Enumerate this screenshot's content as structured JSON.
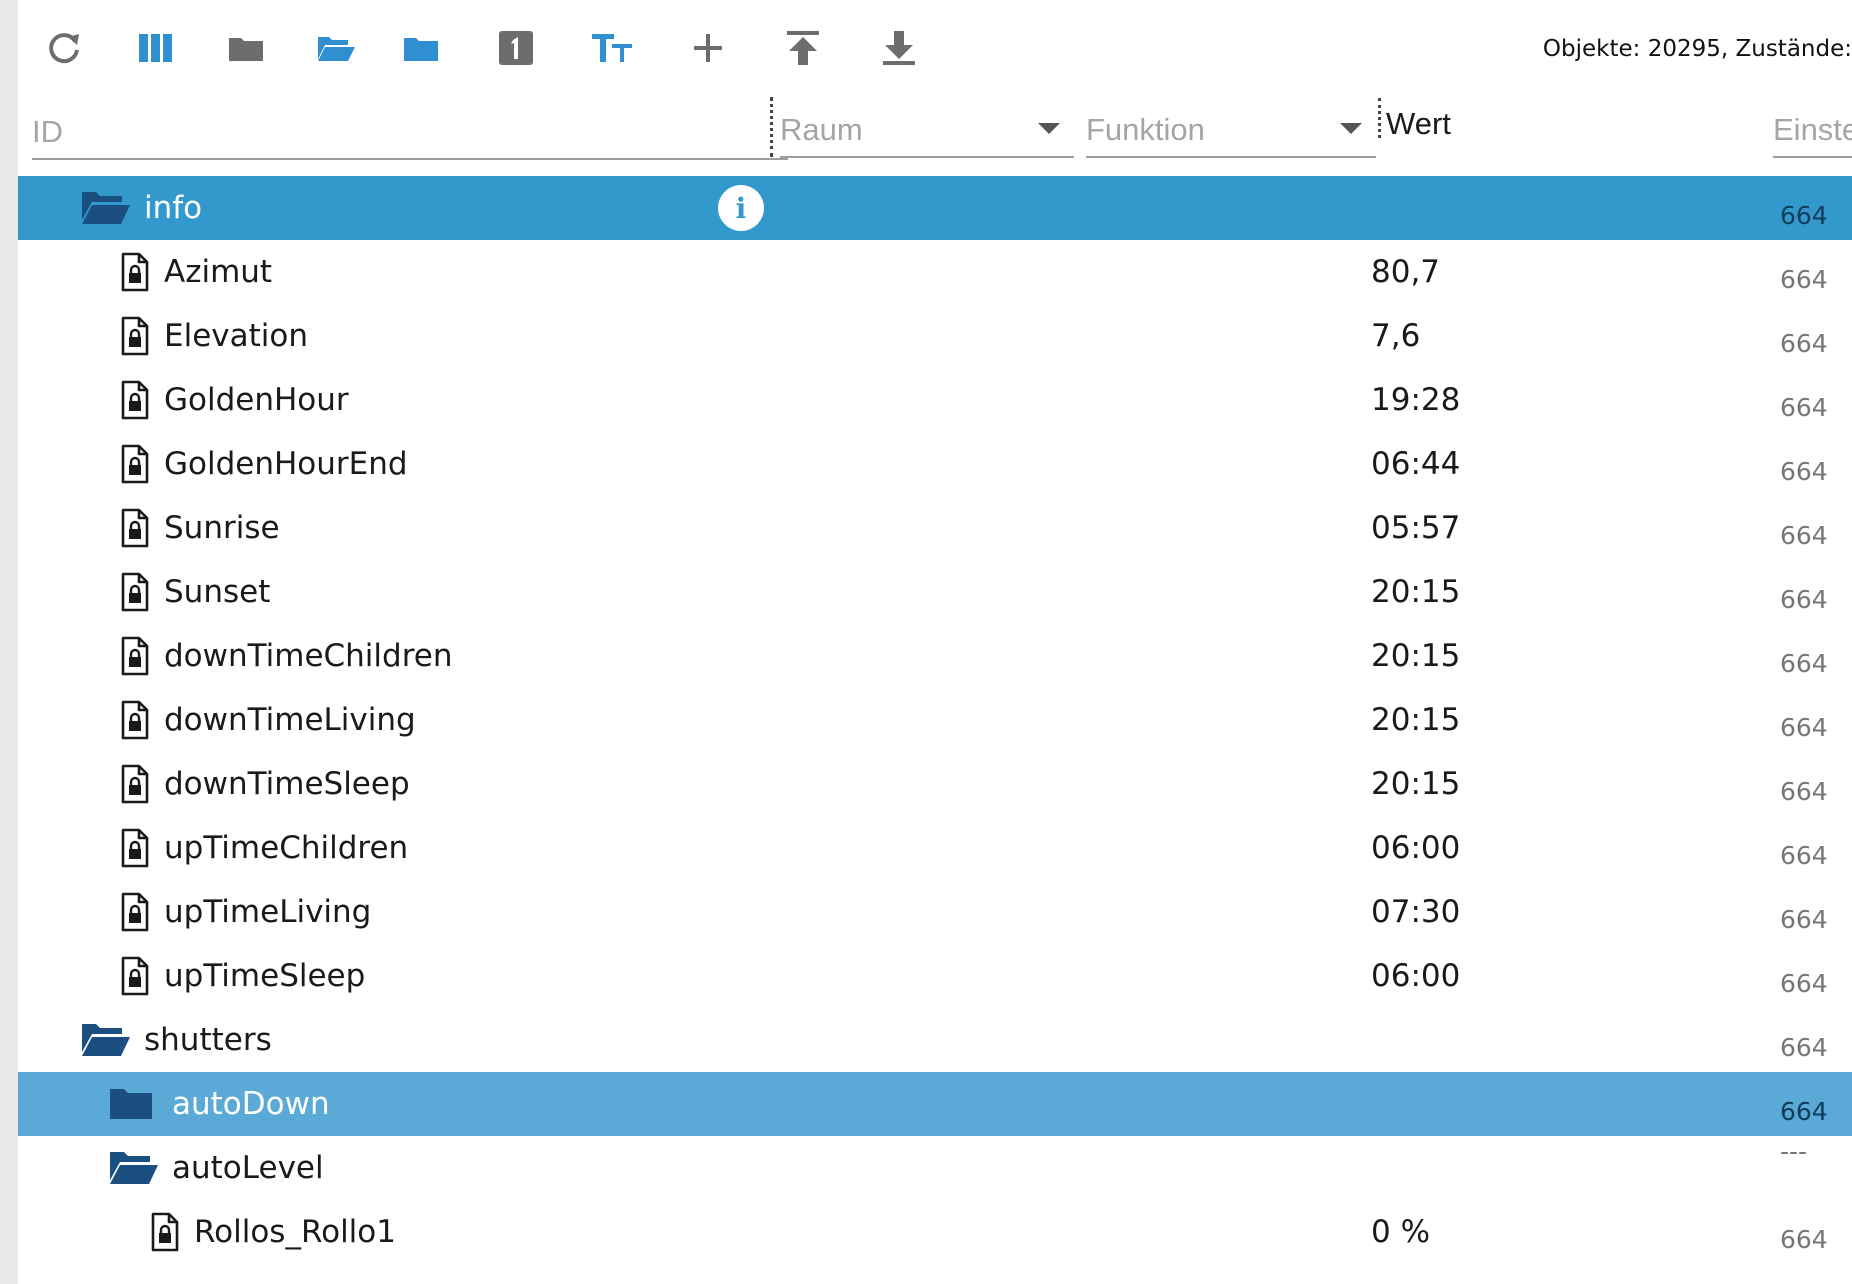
{
  "toolbar": {
    "buttons": [
      {
        "name": "refresh-icon"
      },
      {
        "name": "columns-icon"
      },
      {
        "name": "folder-collapse-icon"
      },
      {
        "name": "folder-open-icon"
      },
      {
        "name": "folder-expand-icon"
      },
      {
        "name": "one-level-icon"
      },
      {
        "name": "text-size-icon"
      },
      {
        "name": "add-icon"
      },
      {
        "name": "upload-icon"
      },
      {
        "name": "download-icon"
      }
    ],
    "status": "Objekte: 20295, Zustände:"
  },
  "columns": {
    "id_placeholder": "ID",
    "room_placeholder": "Raum",
    "function_placeholder": "Funktion",
    "value_header": "Wert",
    "settings_placeholder": "Einste"
  },
  "rows": [
    {
      "label": "info",
      "type": "folder-open",
      "level": 0,
      "selected": "primary",
      "value": "",
      "setting": "664",
      "info": "i"
    },
    {
      "label": "Azimut",
      "type": "state",
      "level": 1,
      "value": "80,7",
      "setting": "664"
    },
    {
      "label": "Elevation",
      "type": "state",
      "level": 1,
      "value": "7,6",
      "setting": "664"
    },
    {
      "label": "GoldenHour",
      "type": "state",
      "level": 1,
      "value": "19:28",
      "setting": "664"
    },
    {
      "label": "GoldenHourEnd",
      "type": "state",
      "level": 1,
      "value": "06:44",
      "setting": "664"
    },
    {
      "label": "Sunrise",
      "type": "state",
      "level": 1,
      "value": "05:57",
      "setting": "664"
    },
    {
      "label": "Sunset",
      "type": "state",
      "level": 1,
      "value": "20:15",
      "setting": "664"
    },
    {
      "label": "downTimeChildren",
      "type": "state",
      "level": 1,
      "value": "20:15",
      "setting": "664"
    },
    {
      "label": "downTimeLiving",
      "type": "state",
      "level": 1,
      "value": "20:15",
      "setting": "664"
    },
    {
      "label": "downTimeSleep",
      "type": "state",
      "level": 1,
      "value": "20:15",
      "setting": "664"
    },
    {
      "label": "upTimeChildren",
      "type": "state",
      "level": 1,
      "value": "06:00",
      "setting": "664"
    },
    {
      "label": "upTimeLiving",
      "type": "state",
      "level": 1,
      "value": "07:30",
      "setting": "664"
    },
    {
      "label": "upTimeSleep",
      "type": "state",
      "level": 1,
      "value": "06:00",
      "setting": "664"
    },
    {
      "label": "shutters",
      "type": "folder-open",
      "level": 0,
      "value": "",
      "setting": "664"
    },
    {
      "label": "autoDown",
      "type": "folder-closed",
      "level": 1,
      "selected": "secondary",
      "value": "",
      "setting": "664"
    },
    {
      "label": "autoLevel",
      "type": "folder-open",
      "level": 1,
      "value": "",
      "setting": "---"
    },
    {
      "label": "Rollos_Rollo1",
      "type": "state",
      "level": 2,
      "value": "0 %",
      "setting": "664"
    }
  ],
  "colors": {
    "selected_primary": "#3399cc",
    "selected_secondary": "#5ba9d6",
    "folder_dark": "#1b4f82",
    "toolbar_blue": "#2f8fd0",
    "toolbar_gray": "#6d6d6d"
  }
}
